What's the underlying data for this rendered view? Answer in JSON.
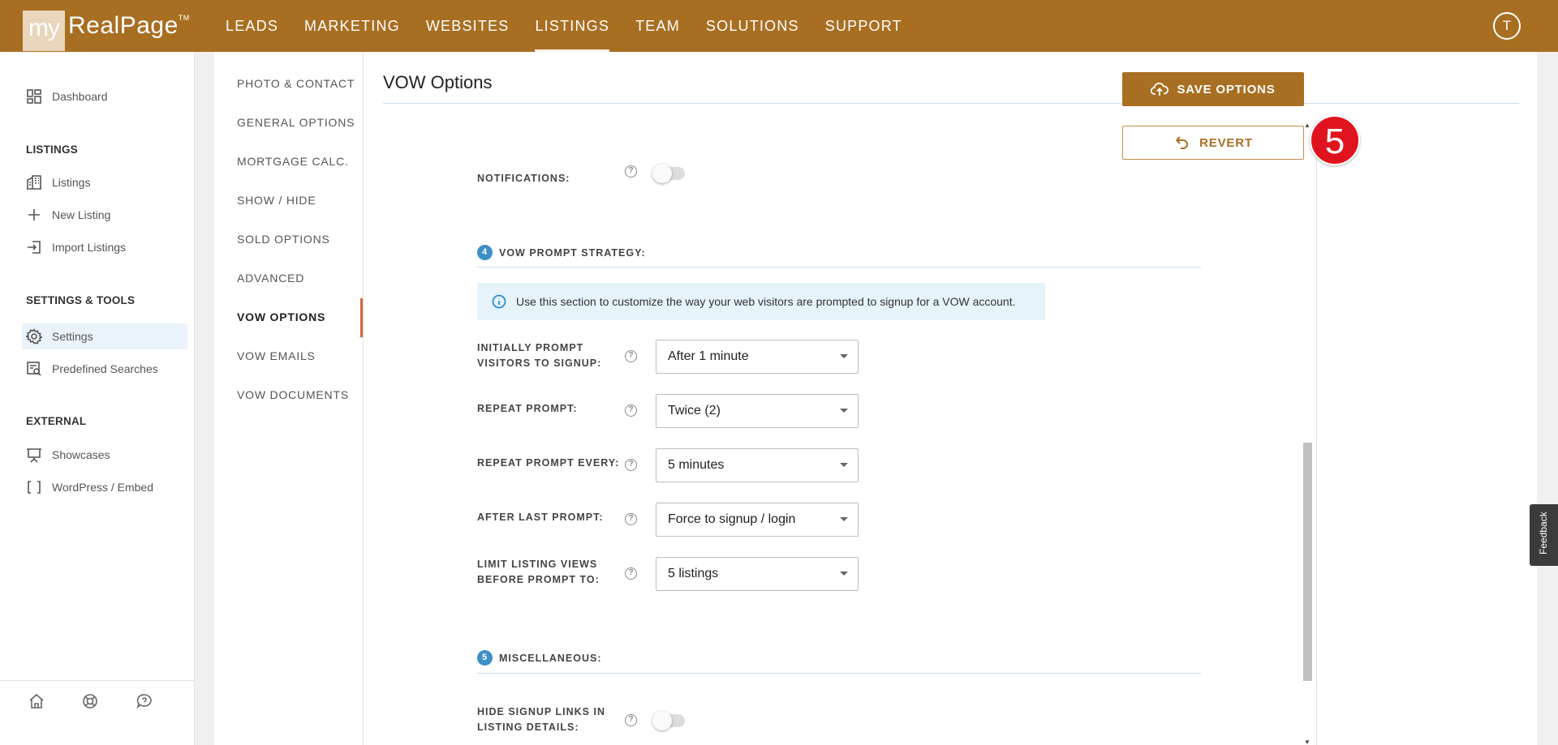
{
  "header": {
    "logo_prefix": "my",
    "logo_main": "RealPage",
    "logo_tm": "TM",
    "nav": [
      {
        "label": "LEADS"
      },
      {
        "label": "MARKETING"
      },
      {
        "label": "WEBSITES"
      },
      {
        "label": "LISTINGS",
        "active": true
      },
      {
        "label": "TEAM"
      },
      {
        "label": "SOLUTIONS"
      },
      {
        "label": "SUPPORT"
      }
    ],
    "avatar_initial": "T"
  },
  "sidebar": {
    "dashboard": "Dashboard",
    "listings_heading": "LISTINGS",
    "listings": "Listings",
    "new_listing": "New Listing",
    "import_listings": "Import Listings",
    "settings_heading": "SETTINGS & TOOLS",
    "settings": "Settings",
    "predefined_searches": "Predefined Searches",
    "external_heading": "EXTERNAL",
    "showcases": "Showcases",
    "wordpress": "WordPress / Embed"
  },
  "subnav": {
    "items": [
      "PHOTO & CONTACT",
      "GENERAL OPTIONS",
      "MORTGAGE CALC.",
      "SHOW / HIDE",
      "SOLD OPTIONS",
      "ADVANCED",
      "VOW OPTIONS",
      "VOW EMAILS",
      "VOW DOCUMENTS"
    ],
    "active": "VOW OPTIONS"
  },
  "content": {
    "title": "VOW Options",
    "notifications_label": "NOTIFICATIONS:",
    "notifications_on": false,
    "section4": {
      "num": "4",
      "title": "VOW PROMPT STRATEGY:"
    },
    "info_text": "Use this section to customize the way your web visitors are prompted to signup for a VOW account.",
    "fields": [
      {
        "label_line1": "INITIALLY PROMPT",
        "label_line2": "VISITORS TO SIGNUP:",
        "value": "After 1 minute"
      },
      {
        "label_line1": "REPEAT PROMPT:",
        "label_line2": "",
        "value": "Twice (2)"
      },
      {
        "label_line1": "REPEAT PROMPT EVERY:",
        "label_line2": "",
        "value": "5 minutes"
      },
      {
        "label_line1": "AFTER LAST PROMPT:",
        "label_line2": "",
        "value": "Force to signup / login"
      },
      {
        "label_line1": "LIMIT LISTING VIEWS",
        "label_line2": "BEFORE PROMPT TO:",
        "value": "5 listings"
      }
    ],
    "section5": {
      "num": "5",
      "title": "MISCELLANEOUS:"
    },
    "hide_signup_line1": "HIDE SIGNUP LINKS IN",
    "hide_signup_line2": "LISTING DETAILS:",
    "hide_signup_on": false,
    "help_glyph": "?"
  },
  "actions": {
    "save_label": "SAVE OPTIONS",
    "revert_label": "REVERT",
    "step_badge": "5"
  },
  "feedback_label": "Feedback",
  "colors": {
    "brand": "#a86f22",
    "accent_blue": "#3d8fc7",
    "step_badge": "#e0141e",
    "active_marker": "#d9643a"
  }
}
